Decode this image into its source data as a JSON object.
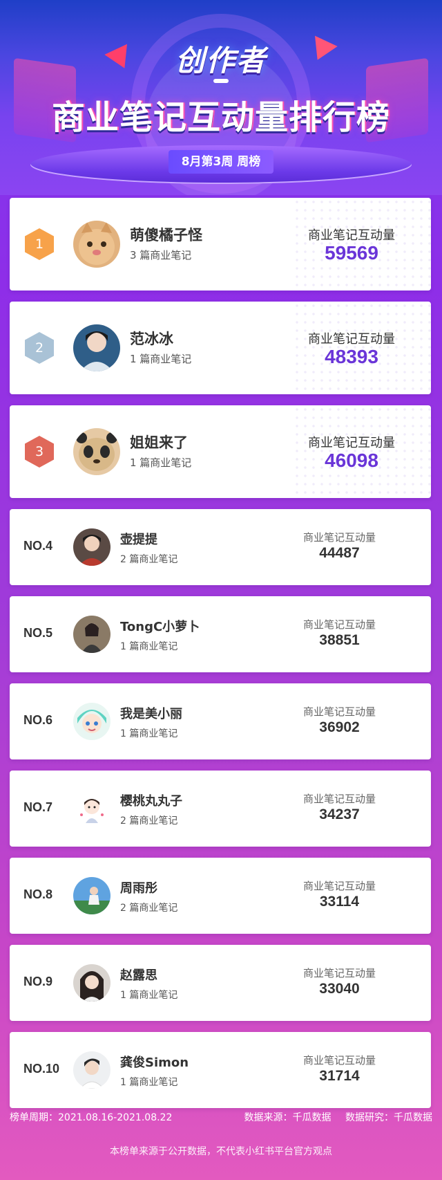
{
  "header": {
    "title_top": "创作者",
    "title_main": "商业笔记互动量排行榜",
    "week_label": "8月第3周 周榜"
  },
  "colors": {
    "background": "#8e2ee8",
    "highlight_value": "#6a35d8",
    "rank1_badge": "#f7a24a",
    "rank2_badge": "#a9c2d6",
    "rank3_badge": "#e0685a"
  },
  "metric_label": "商业笔记互动量",
  "rankings": [
    {
      "rank": "1",
      "badge_color": "#f7a24a",
      "name": "萌傻橘子怪",
      "notes": "3 篇商业笔记",
      "value": "59569",
      "avatar": "cat-avatar"
    },
    {
      "rank": "2",
      "badge_color": "#a9c2d6",
      "name": "范冰冰",
      "notes": "1 篇商业笔记",
      "value": "48393",
      "avatar": "person-avatar"
    },
    {
      "rank": "3",
      "badge_color": "#e0685a",
      "name": "姐姐来了",
      "notes": "1 篇商业笔记",
      "value": "46098",
      "avatar": "panda-avatar"
    },
    {
      "rank": "NO.4",
      "name": "壶提提",
      "notes": "2 篇商业笔记",
      "value": "44487",
      "avatar": "person-avatar"
    },
    {
      "rank": "NO.5",
      "name": "TongC小萝卜",
      "notes": "1 篇商业笔记",
      "value": "38851",
      "avatar": "person-avatar"
    },
    {
      "rank": "NO.6",
      "name": "我是美小丽",
      "notes": "1 篇商业笔记",
      "value": "36902",
      "avatar": "cartoon-avatar"
    },
    {
      "rank": "NO.7",
      "name": "樱桃丸丸子",
      "notes": "2 篇商业笔记",
      "value": "34237",
      "avatar": "cartoon-avatar"
    },
    {
      "rank": "NO.8",
      "name": "周雨彤",
      "notes": "2 篇商业笔记",
      "value": "33114",
      "avatar": "person-avatar"
    },
    {
      "rank": "NO.9",
      "name": "赵露思",
      "notes": "1 篇商业笔记",
      "value": "33040",
      "avatar": "person-avatar"
    },
    {
      "rank": "NO.10",
      "name": "龚俊Simon",
      "notes": "1 篇商业笔记",
      "value": "31714",
      "avatar": "person-avatar"
    }
  ],
  "footer": {
    "period": "榜单周期：2021.08.16-2021.08.22",
    "source": "数据来源：千瓜数据",
    "research": "数据研究：千瓜数据",
    "disclaimer": "本榜单来源于公开数据，不代表小红书平台官方观点"
  }
}
